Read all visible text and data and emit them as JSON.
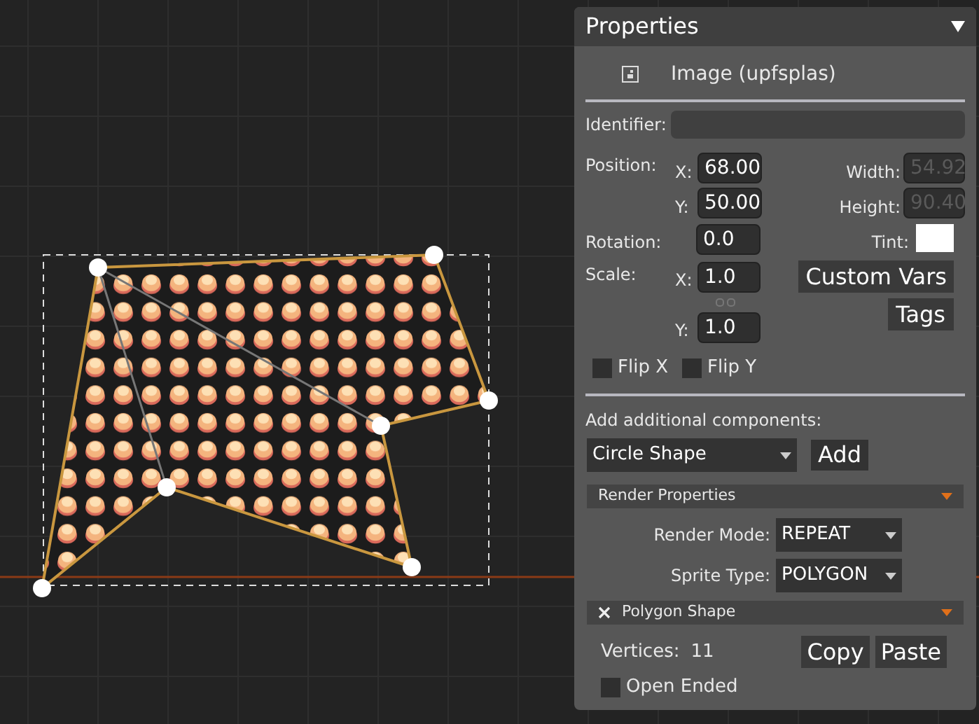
{
  "panel": {
    "title": "Properties",
    "object": {
      "name": "Image (upfsplas)"
    },
    "identifier": {
      "label": "Identifier:"
    },
    "position": {
      "label": "Position:",
      "x": {
        "label": "X:",
        "value": "68.00"
      },
      "y": {
        "label": "Y:",
        "value": "50.00"
      }
    },
    "size": {
      "width": {
        "label": "Width:",
        "value": "54.92",
        "disabled": true
      },
      "height": {
        "label": "Height:",
        "value": "90.40",
        "disabled": true
      }
    },
    "rotation": {
      "label": "Rotation:",
      "value": "0.0"
    },
    "tint": {
      "label": "Tint:",
      "color": "#ffffff"
    },
    "scale": {
      "label": "Scale:",
      "x": {
        "label": "X:",
        "value": "1.0"
      },
      "y": {
        "label": "Y:",
        "value": "1.0"
      }
    },
    "buttons": [
      "Custom Vars",
      "Tags"
    ],
    "flips": [
      {
        "label": "Flip X",
        "checked": false
      },
      {
        "label": "Flip Y",
        "checked": false
      }
    ],
    "add_components": {
      "label": "Add additional components:",
      "dropdown": "Circle Shape",
      "button": "Add"
    },
    "render_properties": {
      "title": "Render Properties",
      "fields": [
        {
          "label": "Render Mode:",
          "value": "REPEAT"
        },
        {
          "label": "Sprite Type:",
          "value": "POLYGON"
        }
      ]
    },
    "polygon_shape": {
      "title": "Polygon Shape",
      "vertices_label": "Vertices:",
      "vertices_value": "11",
      "buttons": [
        "Copy",
        "Paste"
      ],
      "open_ended": {
        "label": "Open Ended",
        "checked": false
      }
    }
  }
}
